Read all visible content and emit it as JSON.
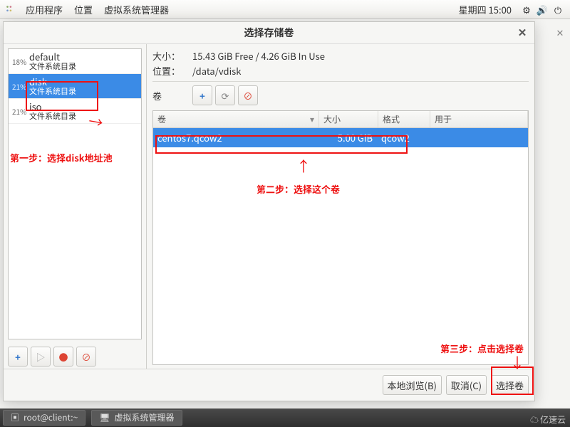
{
  "menubar": {
    "apps_label": "应用程序",
    "places_label": "位置",
    "vmm_label": "虚拟系统管理器",
    "clock": "星期四 15:00"
  },
  "dialog": {
    "title": "选择存储卷",
    "size_label": "大小：",
    "size_value": "15.43 GiB Free / 4.26 GiB In Use",
    "location_label": "位置：",
    "location_value": "/data/vdisk",
    "vol_label": "卷",
    "pools": [
      {
        "pct": "18%",
        "name": "default",
        "sub": "文件系统目录"
      },
      {
        "pct": "21%",
        "name": "disk",
        "sub": "文件系统目录"
      },
      {
        "pct": "21%",
        "name": "iso",
        "sub": "文件系统目录"
      }
    ],
    "columns": {
      "name": "卷",
      "size": "大小",
      "fmt": "格式",
      "used": "用于"
    },
    "volumes": [
      {
        "name": "centos7.qcow2",
        "size": "5.00 GiB",
        "fmt": "qcow2"
      }
    ],
    "buttons": {
      "browse": "本地浏览(B)",
      "cancel": "取消(C)",
      "choose": "选择卷"
    }
  },
  "annotations": {
    "step1": "第一步：选择disk地址池",
    "step2": "第二步：选择这个卷",
    "step3": "第三步：点击选择卷"
  },
  "taskbar": {
    "terminal": "root@client:~",
    "vmm": "虚拟系统管理器"
  },
  "watermark": "亿速云"
}
